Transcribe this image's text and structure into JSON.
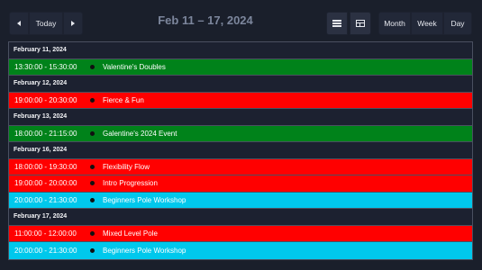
{
  "toolbar": {
    "today_label": "Today",
    "range_title": "Feb 11 – 17, 2024",
    "views": {
      "month": "Month",
      "week": "Week",
      "day": "Day"
    },
    "icons": {
      "prev": "chevron-left-icon",
      "next": "chevron-right-icon",
      "list": "list-icon",
      "grid": "grid-icon"
    }
  },
  "colors": {
    "background": "#1a1f2b",
    "green": "#00821a",
    "red": "#ff0000",
    "cyan": "#00c8ec"
  },
  "days": [
    {
      "label": "February 11, 2024",
      "events": [
        {
          "time": "13:30:00 - 15:30:00",
          "title": "Valentine's Doubles",
          "color": "#00821a"
        }
      ]
    },
    {
      "label": "February 12, 2024",
      "events": [
        {
          "time": "19:00:00 - 20:30:00",
          "title": "Fierce & Fun",
          "color": "#ff0000"
        }
      ]
    },
    {
      "label": "February 13, 2024",
      "events": [
        {
          "time": "18:00:00 - 21:15:00",
          "title": "Galentine's 2024 Event",
          "color": "#00821a"
        }
      ]
    },
    {
      "label": "February 16, 2024",
      "events": [
        {
          "time": "18:00:00 - 19:30:00",
          "title": "Flexibility Flow",
          "color": "#ff0000"
        },
        {
          "time": "19:00:00 - 20:00:00",
          "title": "Intro Progression",
          "color": "#ff0000"
        },
        {
          "time": "20:00:00 - 21:30:00",
          "title": "Beginners Pole Workshop",
          "color": "#00c8ec"
        }
      ]
    },
    {
      "label": "February 17, 2024",
      "events": [
        {
          "time": "11:00:00 - 12:00:00",
          "title": "Mixed Level Pole",
          "color": "#ff0000"
        },
        {
          "time": "20:00:00 - 21:30:00",
          "title": "Beginners Pole Workshop",
          "color": "#00c8ec"
        }
      ]
    }
  ]
}
